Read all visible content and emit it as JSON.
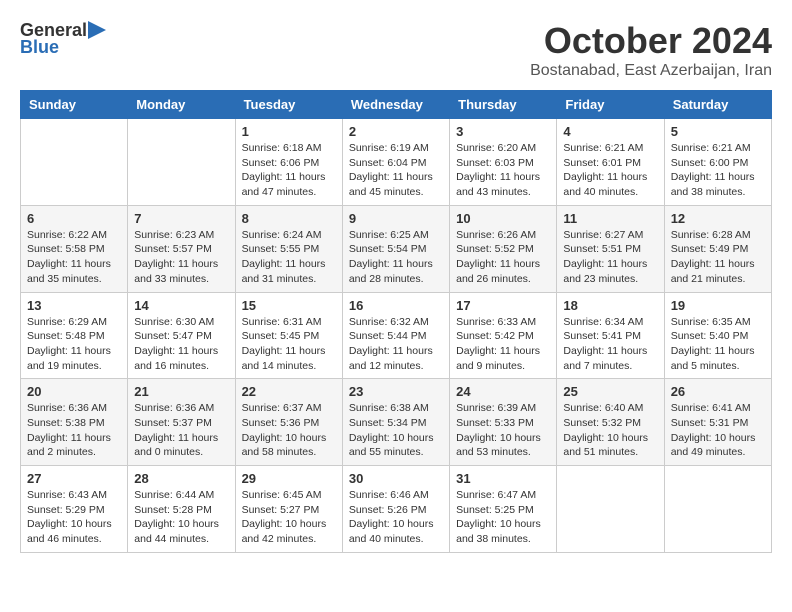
{
  "header": {
    "logo_general": "General",
    "logo_blue": "Blue",
    "month_title": "October 2024",
    "location": "Bostanabad, East Azerbaijan, Iran"
  },
  "days_of_week": [
    "Sunday",
    "Monday",
    "Tuesday",
    "Wednesday",
    "Thursday",
    "Friday",
    "Saturday"
  ],
  "weeks": [
    [
      {
        "day": "",
        "info": ""
      },
      {
        "day": "",
        "info": ""
      },
      {
        "day": "1",
        "info": "Sunrise: 6:18 AM\nSunset: 6:06 PM\nDaylight: 11 hours and 47 minutes."
      },
      {
        "day": "2",
        "info": "Sunrise: 6:19 AM\nSunset: 6:04 PM\nDaylight: 11 hours and 45 minutes."
      },
      {
        "day": "3",
        "info": "Sunrise: 6:20 AM\nSunset: 6:03 PM\nDaylight: 11 hours and 43 minutes."
      },
      {
        "day": "4",
        "info": "Sunrise: 6:21 AM\nSunset: 6:01 PM\nDaylight: 11 hours and 40 minutes."
      },
      {
        "day": "5",
        "info": "Sunrise: 6:21 AM\nSunset: 6:00 PM\nDaylight: 11 hours and 38 minutes."
      }
    ],
    [
      {
        "day": "6",
        "info": "Sunrise: 6:22 AM\nSunset: 5:58 PM\nDaylight: 11 hours and 35 minutes."
      },
      {
        "day": "7",
        "info": "Sunrise: 6:23 AM\nSunset: 5:57 PM\nDaylight: 11 hours and 33 minutes."
      },
      {
        "day": "8",
        "info": "Sunrise: 6:24 AM\nSunset: 5:55 PM\nDaylight: 11 hours and 31 minutes."
      },
      {
        "day": "9",
        "info": "Sunrise: 6:25 AM\nSunset: 5:54 PM\nDaylight: 11 hours and 28 minutes."
      },
      {
        "day": "10",
        "info": "Sunrise: 6:26 AM\nSunset: 5:52 PM\nDaylight: 11 hours and 26 minutes."
      },
      {
        "day": "11",
        "info": "Sunrise: 6:27 AM\nSunset: 5:51 PM\nDaylight: 11 hours and 23 minutes."
      },
      {
        "day": "12",
        "info": "Sunrise: 6:28 AM\nSunset: 5:49 PM\nDaylight: 11 hours and 21 minutes."
      }
    ],
    [
      {
        "day": "13",
        "info": "Sunrise: 6:29 AM\nSunset: 5:48 PM\nDaylight: 11 hours and 19 minutes."
      },
      {
        "day": "14",
        "info": "Sunrise: 6:30 AM\nSunset: 5:47 PM\nDaylight: 11 hours and 16 minutes."
      },
      {
        "day": "15",
        "info": "Sunrise: 6:31 AM\nSunset: 5:45 PM\nDaylight: 11 hours and 14 minutes."
      },
      {
        "day": "16",
        "info": "Sunrise: 6:32 AM\nSunset: 5:44 PM\nDaylight: 11 hours and 12 minutes."
      },
      {
        "day": "17",
        "info": "Sunrise: 6:33 AM\nSunset: 5:42 PM\nDaylight: 11 hours and 9 minutes."
      },
      {
        "day": "18",
        "info": "Sunrise: 6:34 AM\nSunset: 5:41 PM\nDaylight: 11 hours and 7 minutes."
      },
      {
        "day": "19",
        "info": "Sunrise: 6:35 AM\nSunset: 5:40 PM\nDaylight: 11 hours and 5 minutes."
      }
    ],
    [
      {
        "day": "20",
        "info": "Sunrise: 6:36 AM\nSunset: 5:38 PM\nDaylight: 11 hours and 2 minutes."
      },
      {
        "day": "21",
        "info": "Sunrise: 6:36 AM\nSunset: 5:37 PM\nDaylight: 11 hours and 0 minutes."
      },
      {
        "day": "22",
        "info": "Sunrise: 6:37 AM\nSunset: 5:36 PM\nDaylight: 10 hours and 58 minutes."
      },
      {
        "day": "23",
        "info": "Sunrise: 6:38 AM\nSunset: 5:34 PM\nDaylight: 10 hours and 55 minutes."
      },
      {
        "day": "24",
        "info": "Sunrise: 6:39 AM\nSunset: 5:33 PM\nDaylight: 10 hours and 53 minutes."
      },
      {
        "day": "25",
        "info": "Sunrise: 6:40 AM\nSunset: 5:32 PM\nDaylight: 10 hours and 51 minutes."
      },
      {
        "day": "26",
        "info": "Sunrise: 6:41 AM\nSunset: 5:31 PM\nDaylight: 10 hours and 49 minutes."
      }
    ],
    [
      {
        "day": "27",
        "info": "Sunrise: 6:43 AM\nSunset: 5:29 PM\nDaylight: 10 hours and 46 minutes."
      },
      {
        "day": "28",
        "info": "Sunrise: 6:44 AM\nSunset: 5:28 PM\nDaylight: 10 hours and 44 minutes."
      },
      {
        "day": "29",
        "info": "Sunrise: 6:45 AM\nSunset: 5:27 PM\nDaylight: 10 hours and 42 minutes."
      },
      {
        "day": "30",
        "info": "Sunrise: 6:46 AM\nSunset: 5:26 PM\nDaylight: 10 hours and 40 minutes."
      },
      {
        "day": "31",
        "info": "Sunrise: 6:47 AM\nSunset: 5:25 PM\nDaylight: 10 hours and 38 minutes."
      },
      {
        "day": "",
        "info": ""
      },
      {
        "day": "",
        "info": ""
      }
    ]
  ]
}
